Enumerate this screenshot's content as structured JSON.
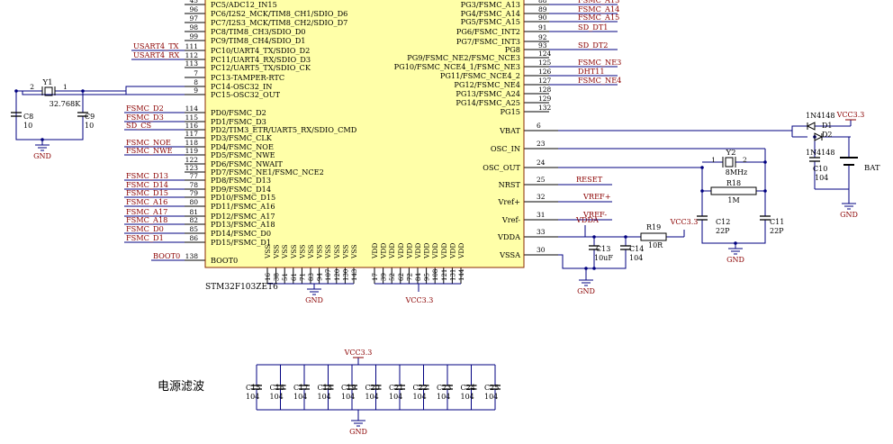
{
  "chip": {
    "part_number": "STM32F103ZET6",
    "left_pins": [
      {
        "name": "PC5/ADC12_IN15",
        "number": "45"
      },
      {
        "name": "PC6/I2S2_MCK/TIM8_CH1/SDIO_D6",
        "number": "96"
      },
      {
        "name": "PC7/I2S3_MCK/TIM8_CH2/SDIO_D7",
        "number": "97"
      },
      {
        "name": "PC8/TIM8_CH3/SDIO_D0",
        "number": "98"
      },
      {
        "name": "PC9/TIM8_CH4/SDIO_D1",
        "number": "99"
      },
      {
        "name": "PC10/UART4_TX/SDIO_D2",
        "number": "111"
      },
      {
        "name": "PC11/UART4_RX/SDIO_D3",
        "number": "112"
      },
      {
        "name": "PC12/UART5_TX/SDIO_CK",
        "number": "113"
      },
      {
        "name": "PC13-TAMPER-RTC",
        "number": "7"
      },
      {
        "name": "PC14-OSC32_IN",
        "number": "8"
      },
      {
        "name": "PC15-OSC32_OUT",
        "number": "9"
      },
      {
        "name": "PD0/FSMC_D2",
        "number": "114"
      },
      {
        "name": "PD1/FSMC_D3",
        "number": "115"
      },
      {
        "name": "PD2/TIM3_ETR/UART5_RX/SDIO_CMD",
        "number": "116"
      },
      {
        "name": "PD3/FSMC_CLK",
        "number": "117"
      },
      {
        "name": "PD4/FSMC_NOE",
        "number": "118"
      },
      {
        "name": "PD5/FSMC_NWE",
        "number": "119"
      },
      {
        "name": "PD6/FSMC_NWAIT",
        "number": "122"
      },
      {
        "name": "PD7/FSMC_NE1/FSMC_NCE2",
        "number": "123"
      },
      {
        "name": "PD8/FSMC_D13",
        "number": "77"
      },
      {
        "name": "PD9/FSMC_D14",
        "number": "78"
      },
      {
        "name": "PD10/FSMC_D15",
        "number": "79"
      },
      {
        "name": "PD11/FSMC_A16",
        "number": "80"
      },
      {
        "name": "PD12/FSMC_A17",
        "number": "81"
      },
      {
        "name": "PD13/FSMC_A18",
        "number": "82"
      },
      {
        "name": "PD14/FSMC_D0",
        "number": "85"
      },
      {
        "name": "PD15/FSMC_D1",
        "number": "86"
      }
    ],
    "boot_pin": {
      "name": "BOOT0",
      "number": "138"
    },
    "right_pins": [
      {
        "name": "PG3/FSMC_A13",
        "number": "88"
      },
      {
        "name": "PG4/FSMC_A14",
        "number": "89"
      },
      {
        "name": "PG5/FSMC_A15",
        "number": "90"
      },
      {
        "name": "PG6/FSMC_INT2",
        "number": "91"
      },
      {
        "name": "PG7/FSMC_INT3",
        "number": "92"
      },
      {
        "name": "PG8",
        "number": "93"
      },
      {
        "name": "PG9/FSMC_NE2/FSMC_NCE3",
        "number": "124"
      },
      {
        "name": "PG10/FSMC_NCE4_1/FSMC_NE3",
        "number": "125"
      },
      {
        "name": "PG11/FSMC_NCE4_2",
        "number": "126"
      },
      {
        "name": "PG12/FSMC_NE4",
        "number": "127"
      },
      {
        "name": "PG13/FSMC_A24",
        "number": "128"
      },
      {
        "name": "PG14/FSMC_A25",
        "number": "129"
      },
      {
        "name": "PG15",
        "number": "132"
      }
    ],
    "power_pins": [
      {
        "name": "VBAT",
        "number": "6"
      },
      {
        "name": "OSC_IN",
        "number": "23"
      },
      {
        "name": "OSC_OUT",
        "number": "24"
      },
      {
        "name": "NRST",
        "number": "25"
      },
      {
        "name": "Vref+",
        "number": "32"
      },
      {
        "name": "Vref-",
        "number": "31"
      },
      {
        "name": "VDDA",
        "number": "33"
      },
      {
        "name": "VSSA",
        "number": "30"
      }
    ],
    "vss_pins": [
      "16",
      "38",
      "51",
      "61",
      "71",
      "83",
      "94",
      "107",
      "120",
      "130",
      "143"
    ],
    "vdd_pins": [
      "17",
      "39",
      "52",
      "62",
      "72",
      "84",
      "95",
      "108",
      "121",
      "131",
      "144"
    ],
    "vss_label": "VSS",
    "vdd_label": "VDD"
  },
  "net_labels": {
    "left": [
      {
        "text": "USART4_TX",
        "pin": "111"
      },
      {
        "text": "USART4_RX",
        "pin": "112"
      },
      {
        "text": "FSMC_D2",
        "pin": "114"
      },
      {
        "text": "FSMC_D3",
        "pin": "115"
      },
      {
        "text": "SD_CS",
        "pin": "116"
      },
      {
        "text": "FSMC_NOE",
        "pin": "118"
      },
      {
        "text": "FSMC_NWE",
        "pin": "119"
      },
      {
        "text": "FSMC_D13",
        "pin": "77"
      },
      {
        "text": "FSMC_D14",
        "pin": "78"
      },
      {
        "text": "FSMC_D15",
        "pin": "79"
      },
      {
        "text": "FSMC_A16",
        "pin": "80"
      },
      {
        "text": "FSMC_A17",
        "pin": "81"
      },
      {
        "text": "FSMC_A18",
        "pin": "82"
      },
      {
        "text": "FSMC_D0",
        "pin": "85"
      },
      {
        "text": "FSMC_D1",
        "pin": "86"
      },
      {
        "text": "BOOT0",
        "pin": "138"
      }
    ],
    "right": [
      {
        "text": "FSMC_A13",
        "pin": "88"
      },
      {
        "text": "FSMC_A14",
        "pin": "89"
      },
      {
        "text": "FSMC_A15",
        "pin": "90"
      },
      {
        "text": "SD_DT1",
        "pin": "91"
      },
      {
        "text": "SD_DT2",
        "pin": "93"
      },
      {
        "text": "FSMC_NE3",
        "pin": "125"
      },
      {
        "text": "DHT11",
        "pin": "126"
      },
      {
        "text": "FSMC_NE4",
        "pin": "127"
      },
      {
        "text": "RESET",
        "pin": "25"
      },
      {
        "text": "VREF+",
        "pin": "32"
      },
      {
        "text": "VREF-",
        "pin": "31"
      },
      {
        "text": "VDDA",
        "pin": "33"
      }
    ]
  },
  "components": {
    "y1": {
      "ref": "Y1",
      "value": "32.768K",
      "pin1": "1",
      "pin2": "2"
    },
    "c8": {
      "ref": "C8",
      "value": "10"
    },
    "c9": {
      "ref": "C9",
      "value": "10"
    },
    "y2": {
      "ref": "Y2",
      "value": "8MHz",
      "pin1": "1",
      "pin2": "2"
    },
    "r18": {
      "ref": "R18",
      "value": "1M"
    },
    "c12": {
      "ref": "C12",
      "value": "22P"
    },
    "c11": {
      "ref": "C11",
      "value": "22P"
    },
    "c13": {
      "ref": "C13",
      "value": "10uF"
    },
    "c14": {
      "ref": "C14",
      "value": "104"
    },
    "r19": {
      "ref": "R19",
      "value": "10R"
    },
    "d1": {
      "ref": "D1",
      "value": "1N4148"
    },
    "d2": {
      "ref": "D2",
      "value": "1N4148"
    },
    "c10": {
      "ref": "C10",
      "value": "104"
    },
    "bat": {
      "ref": "BAT"
    }
  },
  "power": {
    "vcc": "VCC3.3",
    "gnd": "GND"
  },
  "filter": {
    "title": "电源滤波",
    "caps": [
      {
        "ref": "C15",
        "value": "104"
      },
      {
        "ref": "C16",
        "value": "104"
      },
      {
        "ref": "C17",
        "value": "104"
      },
      {
        "ref": "C18",
        "value": "104"
      },
      {
        "ref": "C19",
        "value": "104"
      },
      {
        "ref": "C20",
        "value": "104"
      },
      {
        "ref": "C21",
        "value": "104"
      },
      {
        "ref": "C22",
        "value": "104"
      },
      {
        "ref": "C23",
        "value": "104"
      },
      {
        "ref": "C24",
        "value": "104"
      },
      {
        "ref": "C25",
        "value": "104"
      }
    ]
  },
  "colors": {
    "chip_fill": "#ffffa8",
    "chip_stroke": "#8a2a00",
    "wire": "#000080",
    "net_label": "#8b0000",
    "text": "#000000",
    "power": "#8b0000"
  }
}
